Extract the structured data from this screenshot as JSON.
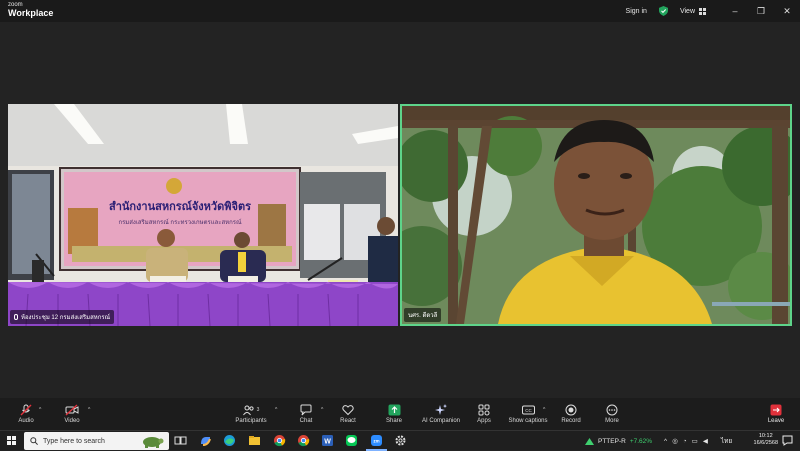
{
  "app": {
    "brand_small": "zoom",
    "brand_big": "Workplace",
    "sign_in": "Sign in",
    "view": "View",
    "minimize": "–",
    "maximize": "❐",
    "close": "✕"
  },
  "participants": [
    {
      "name": "ห้องประชุม 12 กรมส่งเสริมสหกรณ์",
      "banner_line1": "สำนักงานสหกรณ์จังหวัดพิจิตร",
      "banner_line2": "กรมส่งเสริมสหกรณ์ กระทรวงเกษตรและสหกรณ์"
    },
    {
      "name": "นศร. ดีดวลี"
    }
  ],
  "toolbar": {
    "audio": "Audio",
    "video": "Video",
    "participants": "Participants",
    "participants_count": "3",
    "chat": "Chat",
    "react": "React",
    "share": "Share",
    "ai_companion": "AI Companion",
    "apps": "Apps",
    "show_captions": "Show captions",
    "record": "Record",
    "more": "More",
    "leave": "Leave"
  },
  "taskbar": {
    "search_placeholder": "Type here to search",
    "stock_name": "PTTEP-R",
    "stock_change": "+7.62%",
    "language": "ไทย",
    "time": "10:12",
    "date": "16/6/2568"
  },
  "colors": {
    "active_speaker_border": "#5ed48a",
    "share_green": "#22a45d",
    "leave_red": "#e0313b",
    "muted_red": "#e0313b"
  }
}
